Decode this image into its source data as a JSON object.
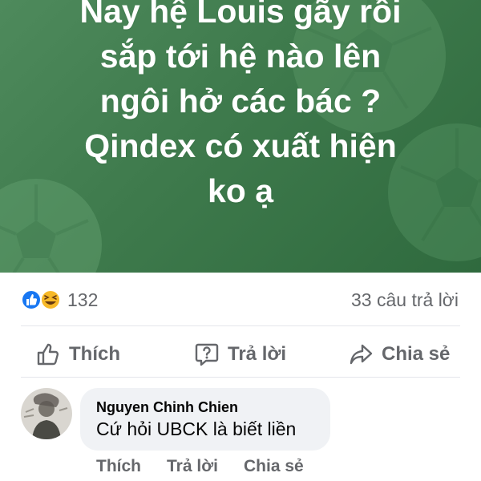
{
  "post": {
    "title_lines": [
      "Nay hệ Louis gãy rồi",
      "sắp tới hệ nào lên",
      "ngôi hở các bác ?",
      "Qindex có xuất hiện",
      "ko ạ"
    ],
    "background_color": "#3e7a4c"
  },
  "stats": {
    "reactions": [
      "like-icon",
      "haha-icon"
    ],
    "reaction_count": "132",
    "reply_count": "33 câu trả lời"
  },
  "actions": {
    "like_label": "Thích",
    "reply_label": "Trả lời",
    "share_label": "Chia sẻ"
  },
  "comment": {
    "author": "Nguyen Chinh Chien",
    "text": "Cứ hỏi UBCK là biết liền",
    "actions": {
      "like_label": "Thích",
      "reply_label": "Trả lời",
      "share_label": "Chia sẻ"
    }
  },
  "colors": {
    "like_blue": "#1877f2",
    "haha_yellow": "#f7b928",
    "secondary_text": "#65676b"
  }
}
